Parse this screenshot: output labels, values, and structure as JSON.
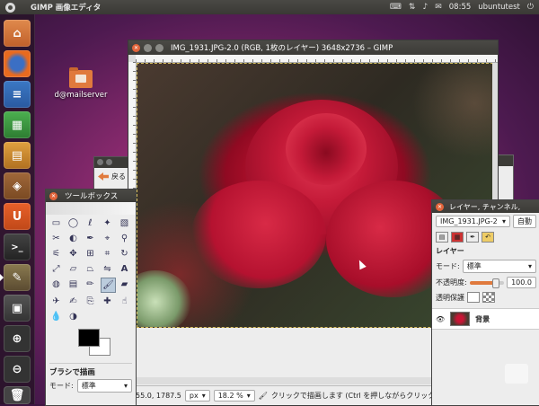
{
  "panel": {
    "app_title": "GIMP 画像エディタ",
    "time": "08:55",
    "user": "ubuntutest"
  },
  "launcher": {
    "items": [
      "home-folder-icon",
      "firefox-icon",
      "writer-icon",
      "calc-icon",
      "impress-icon",
      "software-center-icon",
      "ubuntu-one-icon",
      "terminal-icon",
      "gimp-icon",
      "workspace-switcher-icon",
      "zoom-in-icon",
      "zoom-out-icon",
      "trash-icon"
    ]
  },
  "desktop": {
    "folder_label": "d@mailserver"
  },
  "back_window": {
    "back_label": "戻る"
  },
  "image_window": {
    "title": "IMG_1931.JPG-2.0 (RGB, 1枚のレイヤー) 3648x2736 – GIMP",
    "status": {
      "coords": "55.0, 1787.5",
      "unit": "px",
      "zoom": "18.2 %",
      "message": "クリックで描画します (Ctrl を押しながらクリックでその"
    }
  },
  "toolbox": {
    "title": "ツールボックス",
    "section": "ブラシで描画",
    "mode_label": "モード:",
    "mode_value": "標準"
  },
  "layers": {
    "title": "レイヤー, チャンネル,",
    "image_select": "IMG_1931.JPG-2",
    "auto_label": "自動",
    "tab_label": "レイヤー",
    "mode_label": "モード:",
    "mode_value": "標準",
    "opacity_label": "不透明度:",
    "opacity_value": "100.0",
    "lock_label": "透明保護",
    "layer_name": "背景"
  },
  "colors": {
    "accent": "#e07a3d",
    "rose": "#c81535",
    "panel": "#3c3b37"
  }
}
